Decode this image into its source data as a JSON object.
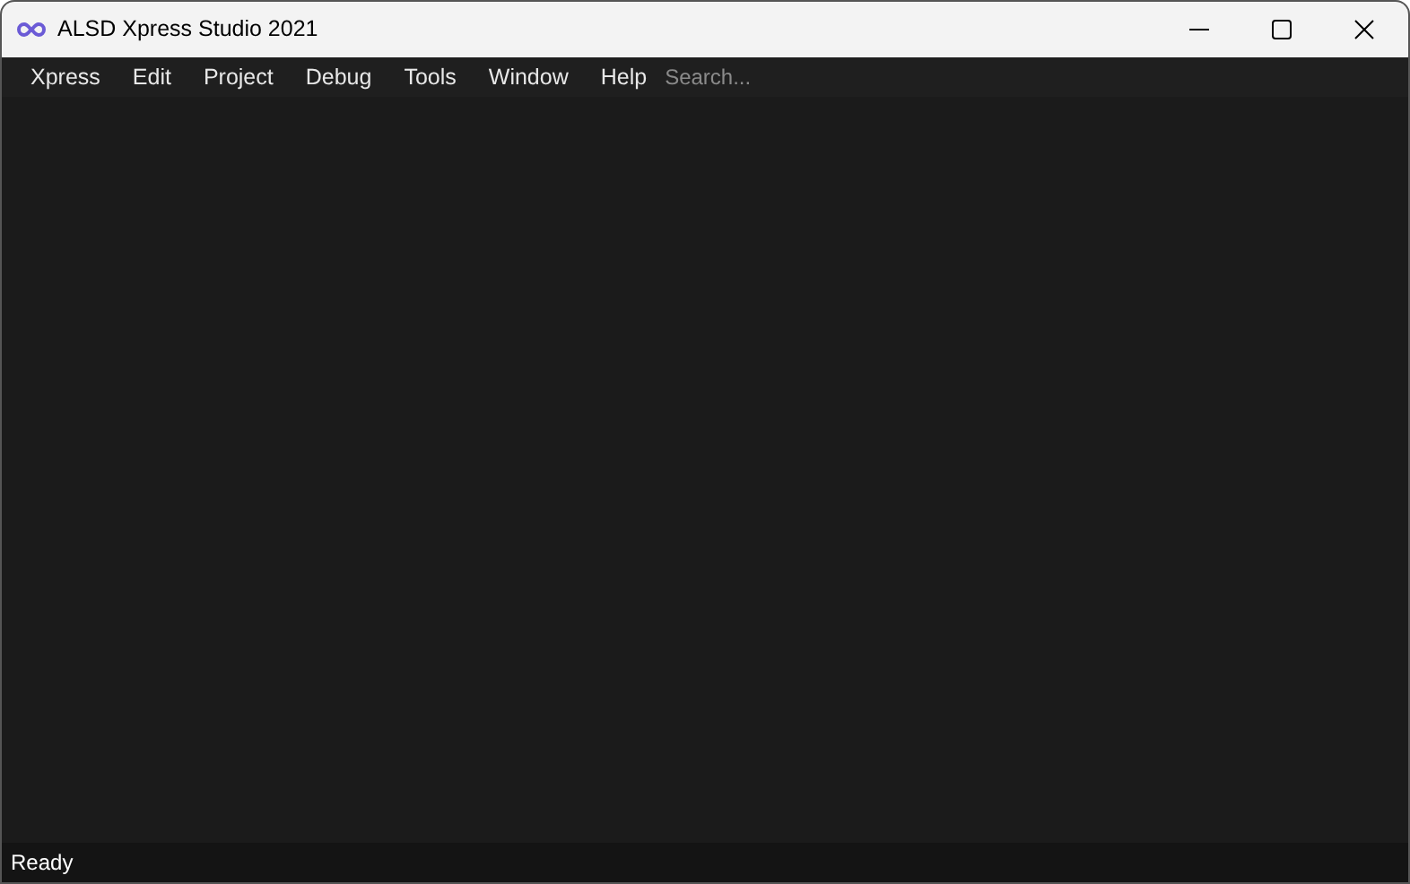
{
  "window": {
    "title": "ALSD Xpress Studio 2021"
  },
  "menu": [
    "Xpress",
    "Edit",
    "Project",
    "Debug",
    "Tools",
    "Window",
    "Help"
  ],
  "search": {
    "placeholder": "Search..."
  },
  "status_bar": "Ready"
}
